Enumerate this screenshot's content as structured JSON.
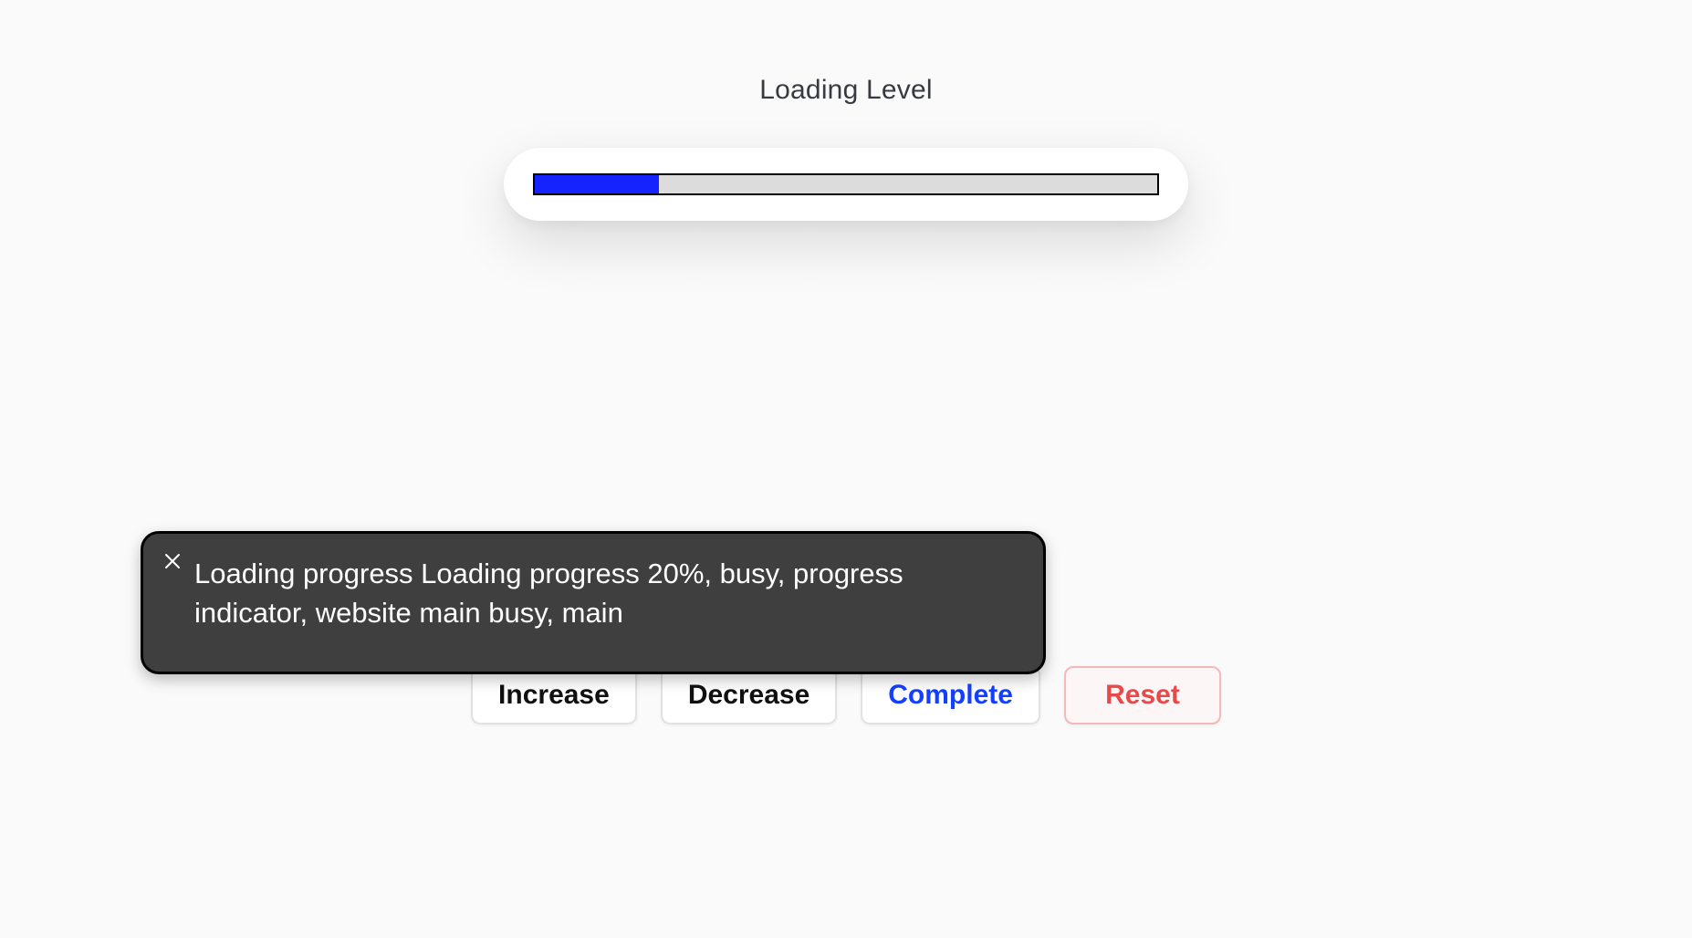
{
  "heading": "Loading Level",
  "progress": {
    "percent": 20
  },
  "buttons": {
    "increase": "Increase",
    "decrease": "Decrease",
    "complete": "Complete",
    "reset": "Reset"
  },
  "a11y": {
    "announcement": "Loading progress Loading progress 20%, busy, progress indicator, website main busy, main"
  }
}
